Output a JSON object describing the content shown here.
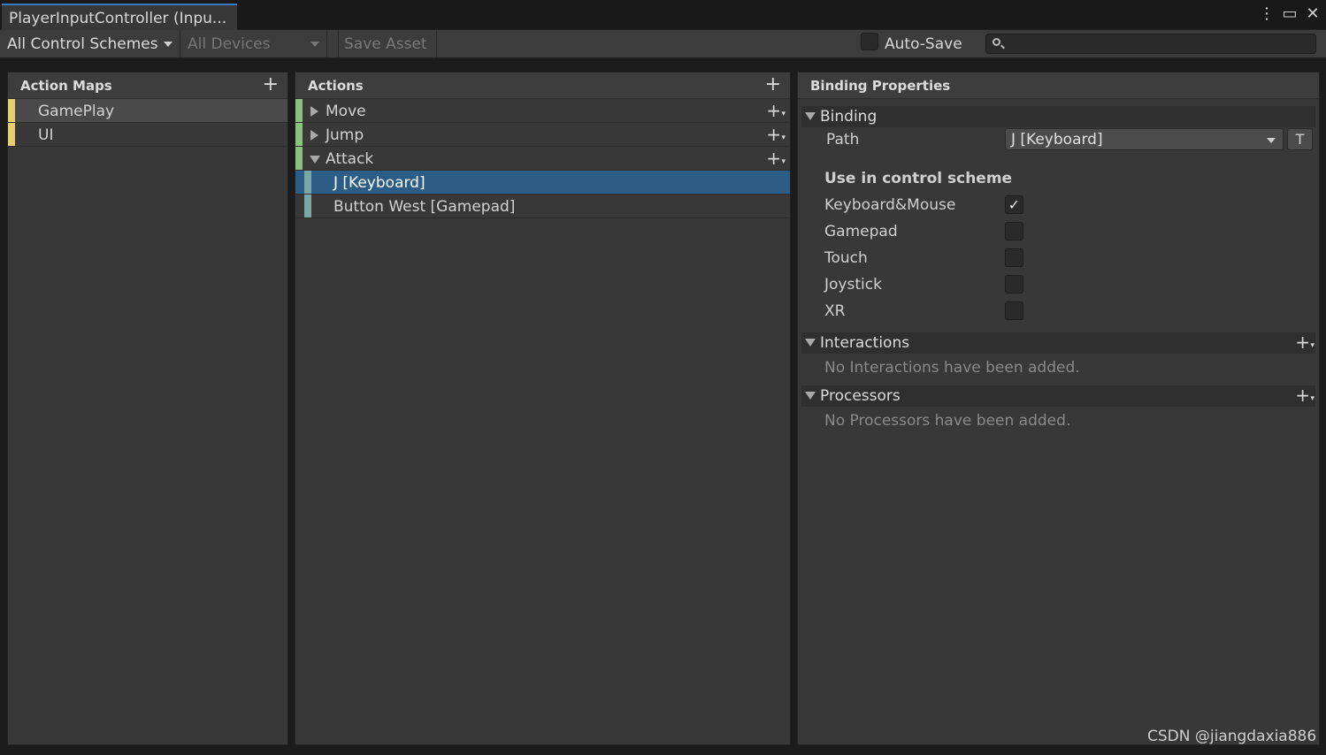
{
  "window": {
    "tab_title": "PlayerInputController (Inpu...",
    "icons": [
      "kebab-menu-icon",
      "maximize-icon",
      "close-icon"
    ]
  },
  "toolbar": {
    "control_schemes": "All Control Schemes",
    "devices": "All Devices",
    "save_asset": "Save Asset",
    "auto_save_label": "Auto-Save",
    "auto_save_checked": false,
    "search_value": ""
  },
  "action_maps": {
    "header": "Action Maps",
    "items": [
      {
        "label": "GamePlay",
        "selected": true
      },
      {
        "label": "UI",
        "selected": false
      }
    ]
  },
  "actions": {
    "header": "Actions",
    "items": [
      {
        "label": "Move",
        "expanded": false
      },
      {
        "label": "Jump",
        "expanded": false
      },
      {
        "label": "Attack",
        "expanded": true
      }
    ],
    "bindings": [
      {
        "label": "J [Keyboard]",
        "selected": true
      },
      {
        "label": "Button West [Gamepad]",
        "selected": false
      }
    ]
  },
  "properties": {
    "header": "Binding Properties",
    "binding_section": "Binding",
    "path_label": "Path",
    "path_value": "J [Keyboard]",
    "t_button": "T",
    "scheme_title": "Use in control scheme",
    "schemes": [
      {
        "label": "Keyboard&Mouse",
        "checked": true
      },
      {
        "label": "Gamepad",
        "checked": false
      },
      {
        "label": "Touch",
        "checked": false
      },
      {
        "label": "Joystick",
        "checked": false
      },
      {
        "label": "XR",
        "checked": false
      }
    ],
    "interactions_section": "Interactions",
    "interactions_empty": "No Interactions have been added.",
    "processors_section": "Processors",
    "processors_empty": "No Processors have been added."
  },
  "colors": {
    "selection_blue": "#2c5d87",
    "map_stripe": "#e6cf6f",
    "action_stripe": "#8ac17f",
    "binding_stripe": "#79a8a6"
  },
  "watermark": "CSDN @jiangdaxia886"
}
